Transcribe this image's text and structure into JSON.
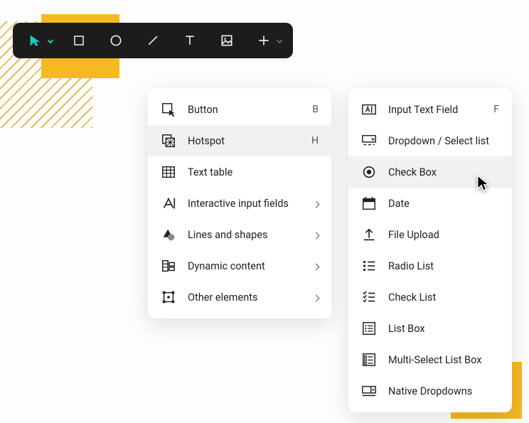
{
  "toolbar": {
    "tools": [
      "pointer",
      "rectangle",
      "circle",
      "line",
      "text",
      "image",
      "add"
    ]
  },
  "menu1": {
    "items": [
      {
        "icon": "button-icon",
        "label": "Button",
        "shortcut": "B"
      },
      {
        "icon": "hotspot-icon",
        "label": "Hotspot",
        "shortcut": "H",
        "hover": true
      },
      {
        "icon": "table-icon",
        "label": "Text table"
      },
      {
        "icon": "input-icon",
        "label": "Interactive input fields",
        "submenu": true
      },
      {
        "icon": "shapes-icon",
        "label": "Lines and shapes",
        "submenu": true
      },
      {
        "icon": "dynamic-icon",
        "label": "Dynamic content",
        "submenu": true
      },
      {
        "icon": "other-icon",
        "label": "Other elements",
        "submenu": true
      }
    ]
  },
  "menu2": {
    "items": [
      {
        "icon": "text-field-icon",
        "label": "Input Text Field",
        "shortcut": "F"
      },
      {
        "icon": "dropdown-icon",
        "label": "Dropdown / Select list"
      },
      {
        "icon": "radio-icon",
        "label": "Check Box",
        "hover": true
      },
      {
        "icon": "date-icon",
        "label": "Date"
      },
      {
        "icon": "upload-icon",
        "label": "File Upload"
      },
      {
        "icon": "radio-list-icon",
        "label": "Radio List"
      },
      {
        "icon": "check-list-icon",
        "label": "Check List"
      },
      {
        "icon": "list-box-icon",
        "label": "List Box"
      },
      {
        "icon": "multi-list-icon",
        "label": "Multi-Select List Box"
      },
      {
        "icon": "native-dd-icon",
        "label": "Native Dropdowns"
      }
    ]
  }
}
